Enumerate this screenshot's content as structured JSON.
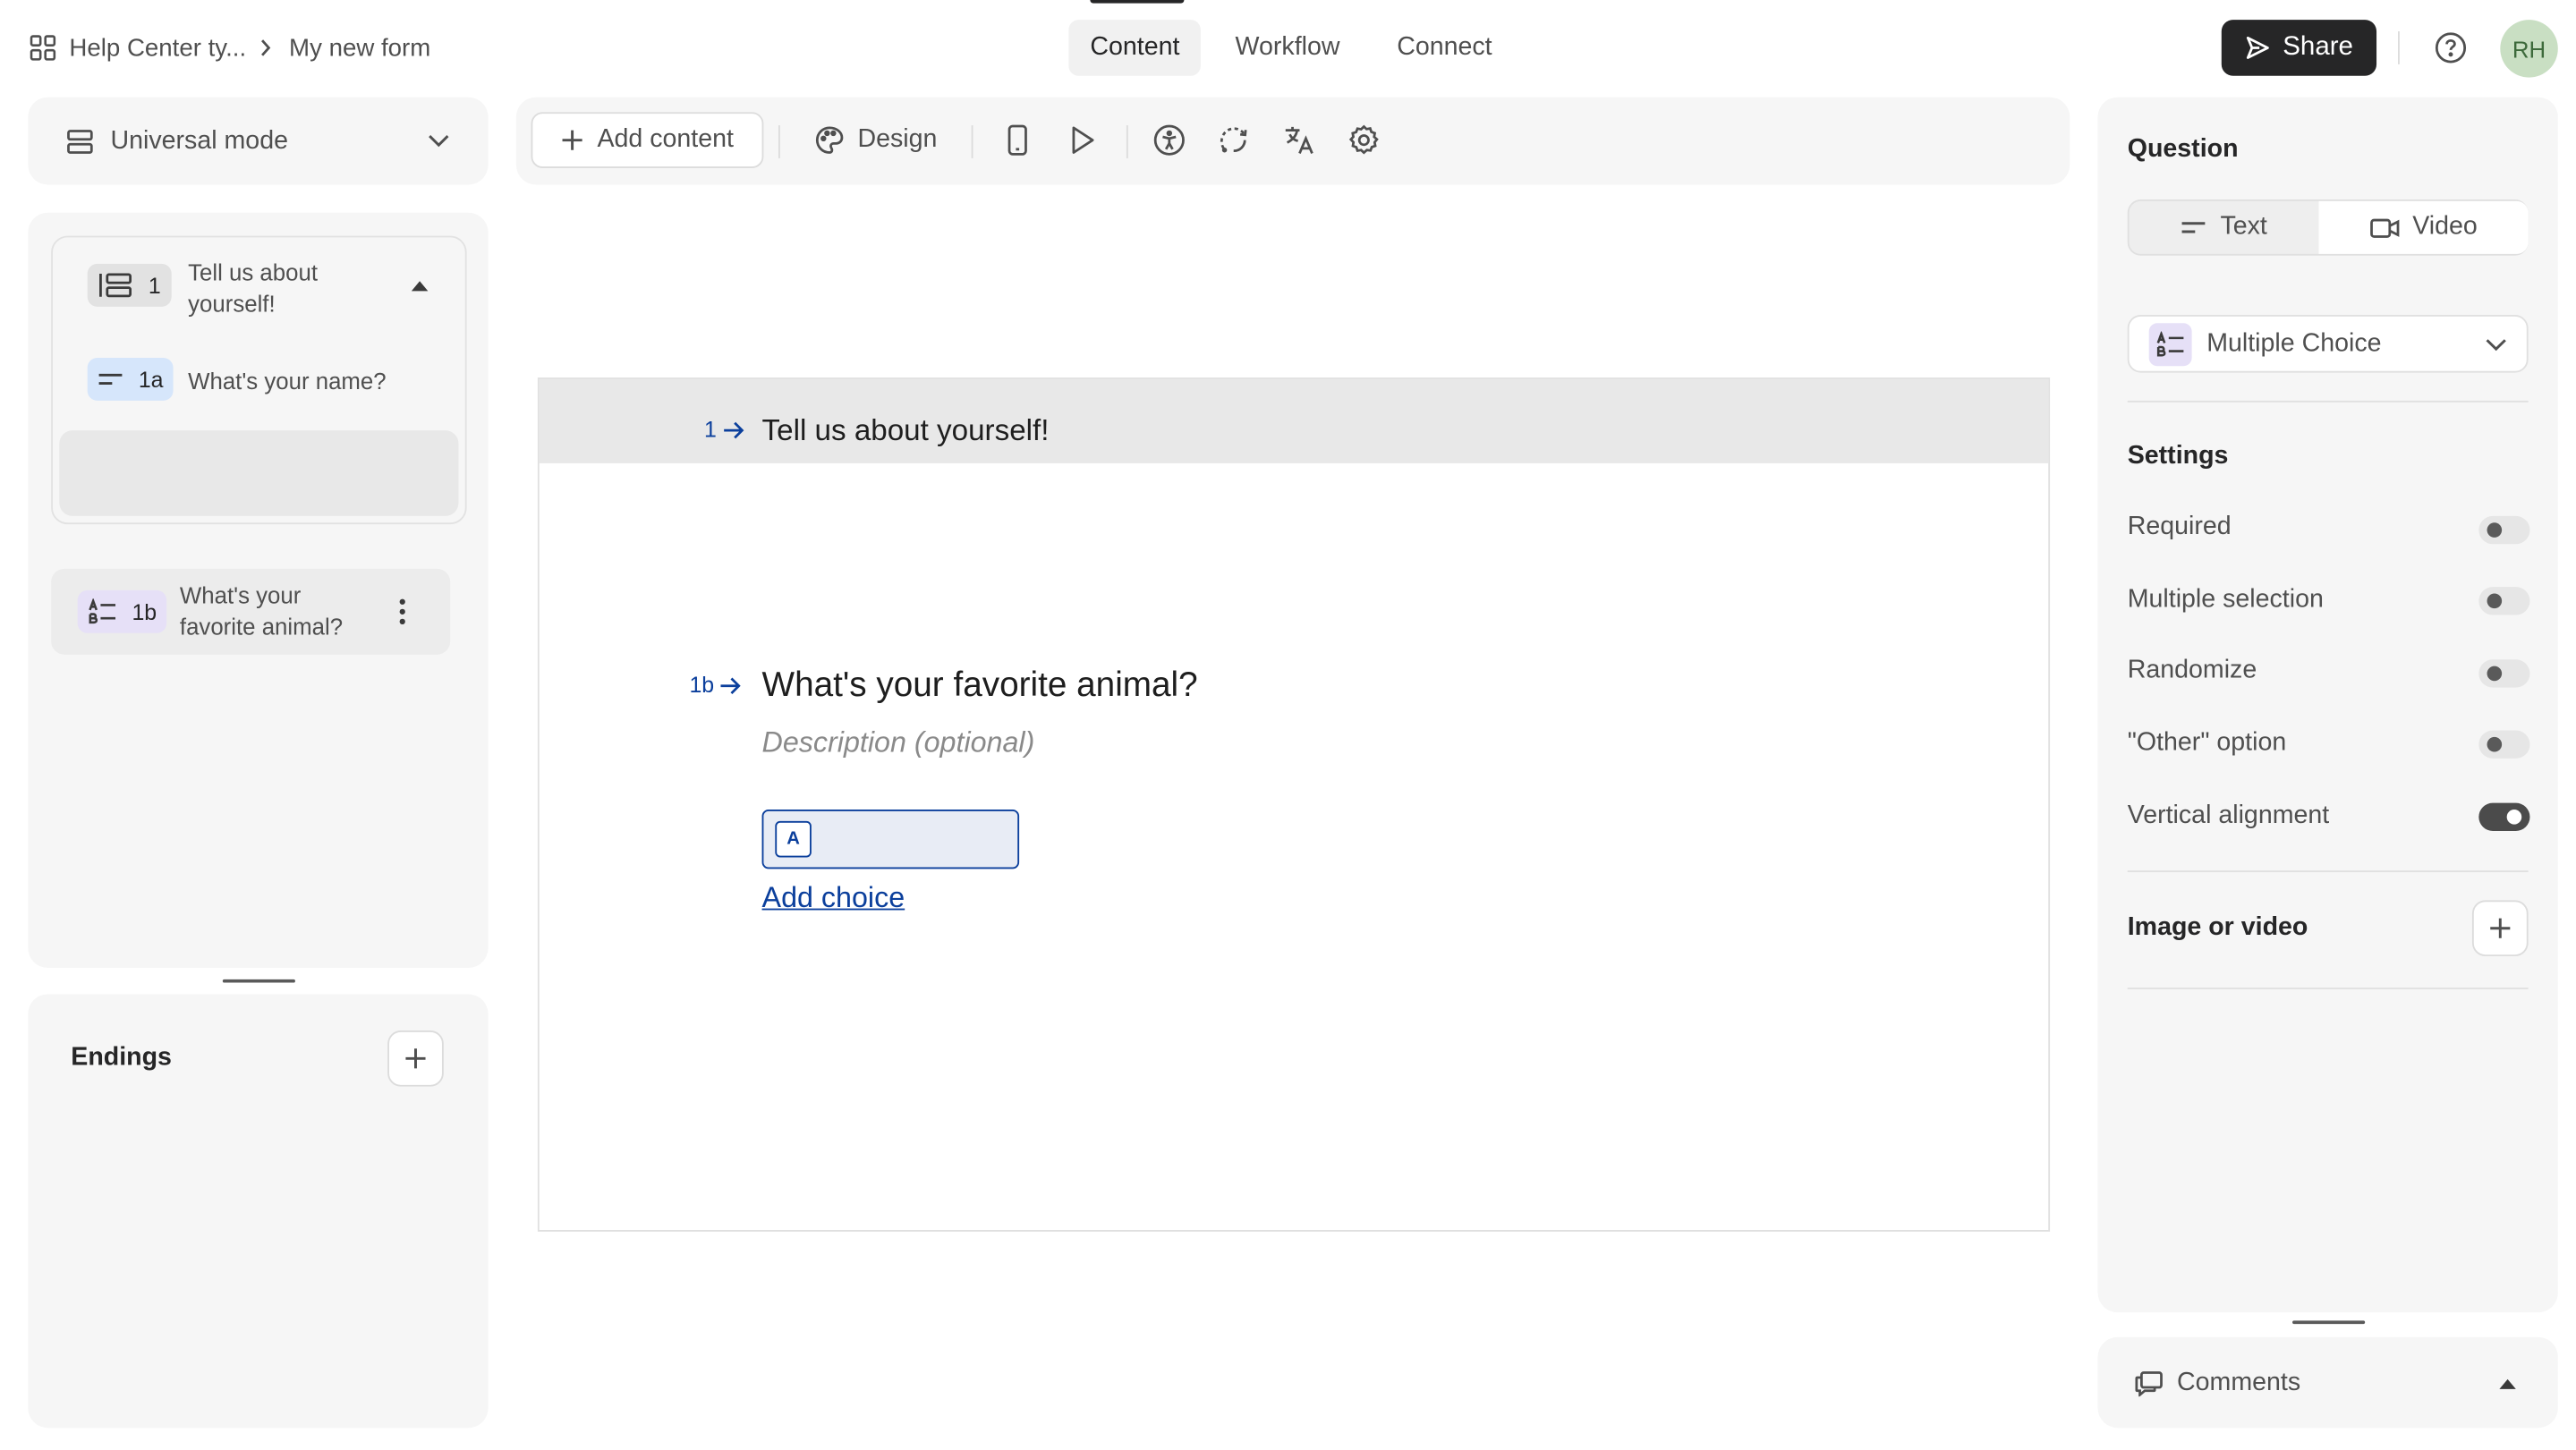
{
  "breadcrumb": {
    "workspace": "Help Center ty...",
    "form": "My new form"
  },
  "tabs": [
    {
      "label": "Content"
    },
    {
      "label": "Workflow"
    },
    {
      "label": "Connect"
    }
  ],
  "header": {
    "share_label": "Share",
    "avatar_initials": "RH"
  },
  "left": {
    "mode_label": "Universal mode",
    "group": {
      "number": "1",
      "title": "Tell us about yourself!"
    },
    "questions": [
      {
        "number": "1a",
        "title": "What's your name?"
      },
      {
        "number": "1b",
        "title": "What's your favorite animal?"
      }
    ],
    "endings_label": "Endings"
  },
  "toolbar": {
    "add_content_label": "Add content",
    "design_label": "Design"
  },
  "canvas": {
    "group_number": "1",
    "group_title": "Tell us about yourself!",
    "question_number": "1b",
    "question_title": "What's your favorite animal?",
    "description_placeholder": "Description (optional)",
    "choice_key": "A",
    "add_choice_label": "Add choice"
  },
  "right": {
    "question_heading": "Question",
    "text_label": "Text",
    "video_label": "Video",
    "type_label": "Multiple Choice",
    "settings_heading": "Settings",
    "settings": [
      {
        "label": "Required",
        "on": false
      },
      {
        "label": "Multiple selection",
        "on": false
      },
      {
        "label": "Randomize",
        "on": false
      },
      {
        "label": "\"Other\" option",
        "on": false
      },
      {
        "label": "Vertical alignment",
        "on": true
      }
    ],
    "media_label": "Image or video",
    "comments_label": "Comments"
  },
  "colors": {
    "accent_dark": "#262627",
    "chip_blue": "#d6e6fb",
    "chip_purple": "#e6e0f7",
    "link_blue": "#0b3f9c"
  }
}
